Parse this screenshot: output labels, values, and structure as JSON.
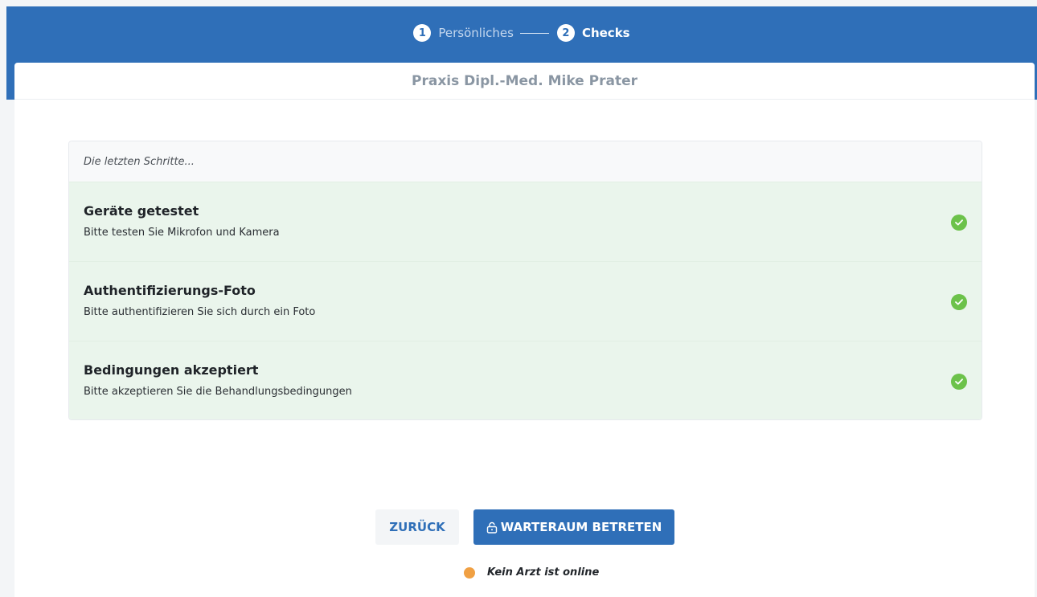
{
  "stepper": {
    "steps": [
      {
        "number": "1",
        "label": "Persönliches"
      },
      {
        "number": "2",
        "label": "Checks"
      }
    ]
  },
  "card": {
    "title": "Praxis Dipl.-Med. Mike Prater"
  },
  "checks": {
    "heading": "Die letzten Schritte...",
    "items": [
      {
        "title": "Geräte getestet",
        "description": "Bitte testen Sie Mikrofon und Kamera",
        "icon": "check-circle-icon"
      },
      {
        "title": "Authentifizierungs-Foto",
        "description": "Bitte authentifizieren Sie sich durch ein Foto",
        "icon": "check-circle-icon"
      },
      {
        "title": "Bedingungen akzeptiert",
        "description": "Bitte akzeptieren Sie die Behandlungsbedingungen",
        "icon": "check-circle-icon"
      }
    ]
  },
  "actions": {
    "back_label": "ZURÜCK",
    "enter_label": "WARTERAUM BETRETEN",
    "enter_icon": "lock-open-icon"
  },
  "status": {
    "text": "Kein Arzt ist online",
    "color": "#f0a043"
  },
  "colors": {
    "primary": "#2f6fb8",
    "success": "#6cc24a",
    "success_bg": "#eaf5ec"
  }
}
